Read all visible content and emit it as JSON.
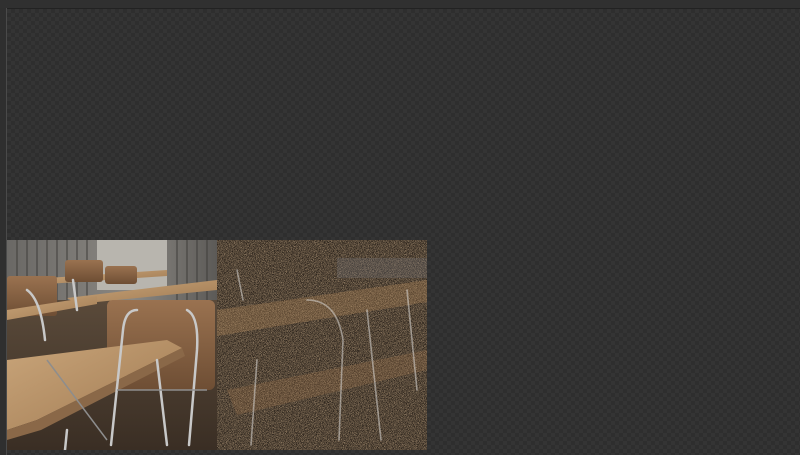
{
  "viewer": {
    "background": "checkerboard",
    "accent": "#2d2d2d"
  },
  "render": {
    "subject": "classroom-desks-render",
    "left_region": "denoised",
    "right_region": "noisy-progressive"
  },
  "icons": {
    "canvas": "render-preview-image"
  }
}
